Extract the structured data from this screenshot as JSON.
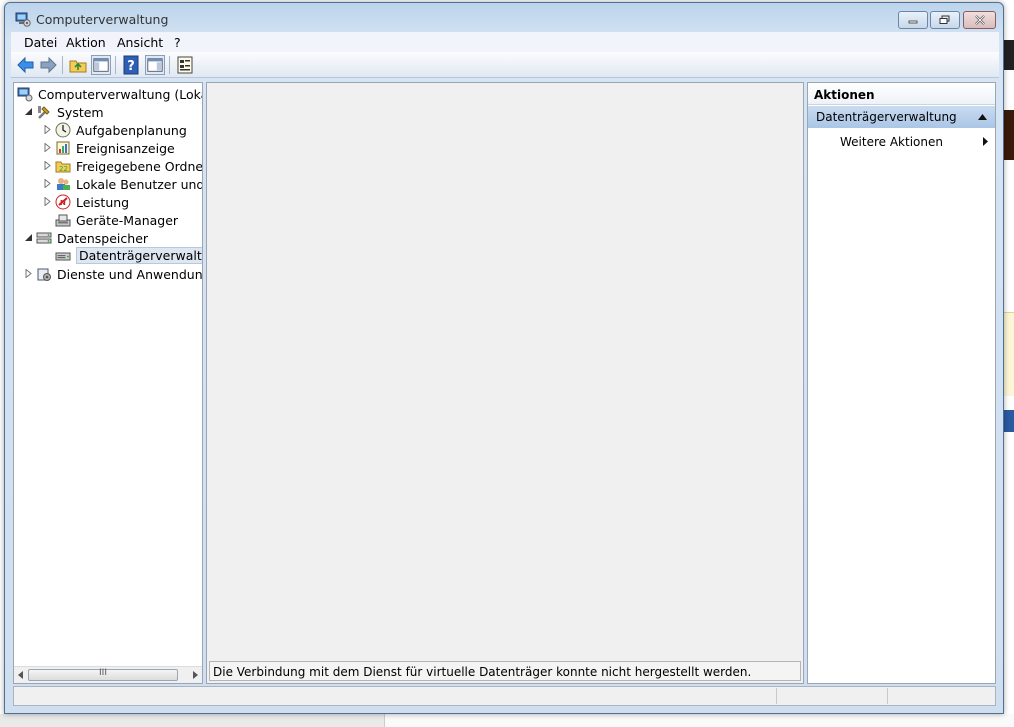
{
  "window": {
    "title": "Computerverwaltung"
  },
  "menu": {
    "datei": "Datei",
    "aktion": "Aktion",
    "ansicht": "Ansicht",
    "help": "?"
  },
  "tree": {
    "items": [
      {
        "label": "Computerverwaltung (Lokal)",
        "icon": "computer-management-icon",
        "level": 0,
        "expander": "none"
      },
      {
        "label": "System",
        "icon": "system-tools-icon",
        "level": 1,
        "expander": "expanded"
      },
      {
        "label": "Aufgabenplanung",
        "icon": "clock-icon",
        "level": 2,
        "expander": "collapsed"
      },
      {
        "label": "Ereignisanzeige",
        "icon": "event-viewer-icon",
        "level": 2,
        "expander": "collapsed"
      },
      {
        "label": "Freigegebene Ordner",
        "icon": "shared-folder-icon",
        "level": 2,
        "expander": "collapsed"
      },
      {
        "label": "Lokale Benutzer und Gruppen",
        "icon": "users-icon",
        "level": 2,
        "expander": "collapsed"
      },
      {
        "label": "Leistung",
        "icon": "performance-icon",
        "level": 2,
        "expander": "collapsed"
      },
      {
        "label": "Geräte-Manager",
        "icon": "device-manager-icon",
        "level": 2,
        "expander": "none"
      },
      {
        "label": "Datenspeicher",
        "icon": "storage-icon",
        "level": 1,
        "expander": "expanded"
      },
      {
        "label": "Datenträgerverwaltung",
        "icon": "disk-management-icon",
        "level": 2,
        "expander": "none",
        "selected": true
      },
      {
        "label": "Dienste und Anwendungen",
        "icon": "services-icon",
        "level": 1,
        "expander": "collapsed"
      }
    ],
    "scroll_grip": "III"
  },
  "center": {
    "status_message": "Die Verbindung mit dem Dienst für virtuelle Datenträger konnte nicht hergestellt werden."
  },
  "actions": {
    "header": "Aktionen",
    "section_title": "Datenträgerverwaltung",
    "more_actions": "Weitere Aktionen"
  },
  "colors": {
    "section_highlight": "#aac6e6",
    "selection": "#dde6f1"
  }
}
